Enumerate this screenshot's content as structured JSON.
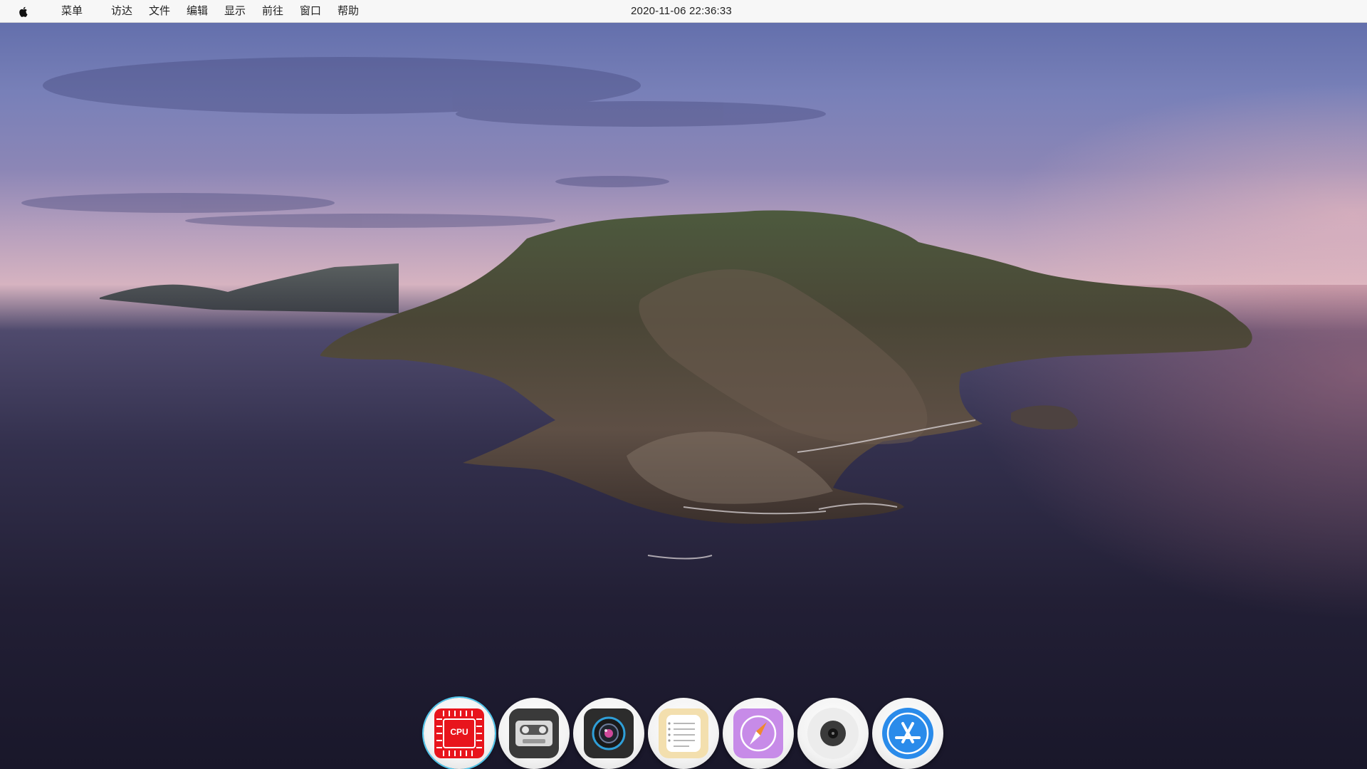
{
  "menubar": {
    "apple_icon": "apple-logo-icon",
    "items": [
      "菜单",
      "访达",
      "文件",
      "编辑",
      "显示",
      "前往",
      "窗口",
      "帮助"
    ],
    "clock": "2020-11-06 22:36:33"
  },
  "dock": {
    "apps": [
      {
        "icon": "cpu-icon",
        "label": "CPU",
        "active": true,
        "color": "#e8141c"
      },
      {
        "icon": "cassette-tape-icon",
        "color": "#3a3a3a"
      },
      {
        "icon": "camera-lens-icon",
        "color": "#2c2c2c"
      },
      {
        "icon": "notes-icon",
        "color": "#f3dfae"
      },
      {
        "icon": "compass-icon",
        "color": "#c78be8"
      },
      {
        "icon": "disc-player-icon",
        "color": "#eeeeee"
      },
      {
        "icon": "app-store-icon",
        "color": "#2a8bea"
      }
    ]
  },
  "wallpaper": {
    "scene": "coastal-island-icon"
  }
}
